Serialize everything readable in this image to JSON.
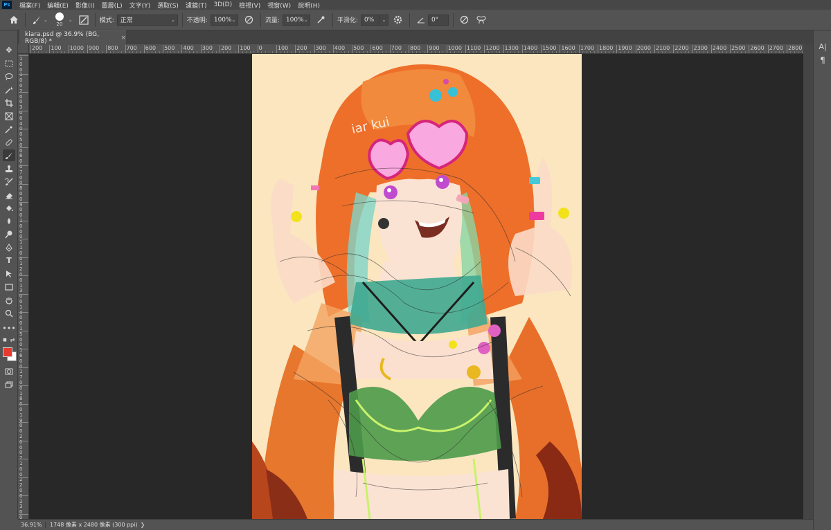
{
  "app": {
    "logo": "Ps"
  },
  "menu": [
    "檔案(F)",
    "編輯(E)",
    "影像(I)",
    "圖層(L)",
    "文字(Y)",
    "選取(S)",
    "濾鏡(T)",
    "3D(D)",
    "檢視(V)",
    "視窗(W)",
    "說明(H)"
  ],
  "options": {
    "brush_size": "20",
    "mode_label": "模式:",
    "mode_value": "正常",
    "opacity_label": "不透明:",
    "opacity_value": "100%",
    "flow_label": "流量:",
    "flow_value": "100%",
    "smoothing_label": "平滑化:",
    "smoothing_value": "0%",
    "angle_value": "0°"
  },
  "document": {
    "tab_title": "kiara.psd @ 36.9% (BG, RGB/8) *",
    "close_glyph": "×"
  },
  "ruler_h": [
    "200",
    "100",
    "1000",
    "900",
    "800",
    "700",
    "600",
    "500",
    "400",
    "300",
    "200",
    "100",
    "0",
    "100",
    "200",
    "300",
    "400",
    "500",
    "600",
    "700",
    "800",
    "900",
    "1000",
    "1100",
    "1200",
    "1300",
    "1400",
    "1500",
    "1600",
    "1700",
    "1800",
    "1900",
    "2000",
    "2100",
    "2200",
    "2300",
    "2400",
    "2500",
    "2600",
    "2700",
    "2800",
    "2"
  ],
  "ruler_v": [
    "1",
    "0",
    "0",
    "1",
    "0",
    "0",
    "2",
    "0",
    "0",
    "3",
    "0",
    "0",
    "4",
    "0",
    "0",
    "5",
    "0",
    "0",
    "6",
    "0",
    "0",
    "7",
    "0",
    "0",
    "8",
    "0",
    "0",
    "9",
    "0",
    "0",
    "1",
    "0",
    "0",
    "0",
    "1",
    "1",
    "0",
    "0",
    "1",
    "2",
    "0",
    "0",
    "1",
    "3",
    "0",
    "0",
    "1",
    "4",
    "0",
    "0",
    "1",
    "5",
    "0",
    "0",
    "1",
    "6",
    "0",
    "0",
    "1",
    "7",
    "0",
    "0",
    "1",
    "8",
    "0",
    "0",
    "1",
    "9",
    "0",
    "0",
    "2",
    "0",
    "0",
    "0",
    "2",
    "1",
    "0",
    "0",
    "2",
    "2",
    "0",
    "0",
    "2",
    "3",
    "0",
    "0",
    "2",
    "4"
  ],
  "status": {
    "zoom": "36.91%",
    "info": "1748 像素 x 2480 像素 (300 ppi)",
    "arrow": "❯"
  },
  "colors": {
    "foreground": "#e8392e",
    "background": "#ffffff",
    "canvas_bg": "#fbe6bf",
    "workspace": "#282828"
  },
  "artwork": {
    "text_on_art": "iar kui"
  },
  "tools": [
    "move-icon",
    "marquee-icon",
    "lasso-icon",
    "magic-wand-icon",
    "crop-icon",
    "frame-icon",
    "eyedropper-icon",
    "healing-icon",
    "brush-icon",
    "stamp-icon",
    "history-brush-icon",
    "eraser-icon",
    "bucket-icon",
    "blur-icon",
    "dodge-icon",
    "pen-icon",
    "type-icon",
    "path-select-icon",
    "rectangle-icon",
    "hand-icon",
    "zoom-icon",
    "more-icon"
  ],
  "right_panel": {
    "char_label": "A|",
    "para_label": "¶"
  }
}
